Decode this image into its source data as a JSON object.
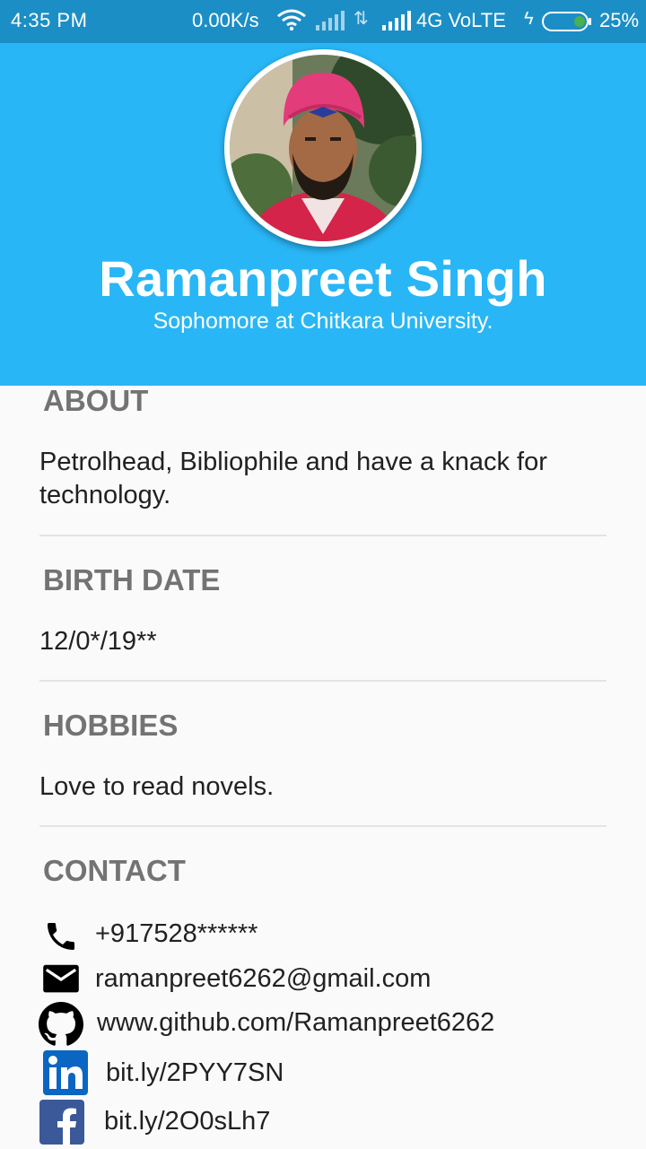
{
  "status_bar": {
    "time": "4:35 PM",
    "network_speed": "0.00K/s",
    "network_type": "4G VoLTE",
    "battery": "25%"
  },
  "profile": {
    "name": "Ramanpreet Singh",
    "subtitle": "Sophomore at Chitkara University."
  },
  "sections": {
    "about": {
      "heading": "ABOUT",
      "text": "Petrolhead, Bibliophile and have a knack for technology."
    },
    "birth_date": {
      "heading": "BIRTH DATE",
      "text": "12/0*/19**"
    },
    "hobbies": {
      "heading": "HOBBIES",
      "text": "Love to read novels."
    },
    "contact": {
      "heading": "CONTACT",
      "phone": "+917528******",
      "email": "ramanpreet6262@gmail.com",
      "github": "www.github.com/Ramanpreet6262",
      "linkedin": "bit.ly/2PYY7SN",
      "facebook": "bit.ly/2O0sLh7"
    }
  },
  "icons": {
    "phone": "phone-icon",
    "email": "mail-icon",
    "github": "github-icon",
    "linkedin": "linkedin-icon",
    "facebook": "facebook-icon"
  },
  "colors": {
    "status_bar": "#1c8ec6",
    "header": "#29b6f6",
    "heading_text": "#737373",
    "body_text": "#212121",
    "linkedin": "#0a66c2",
    "facebook": "#3b5998"
  }
}
